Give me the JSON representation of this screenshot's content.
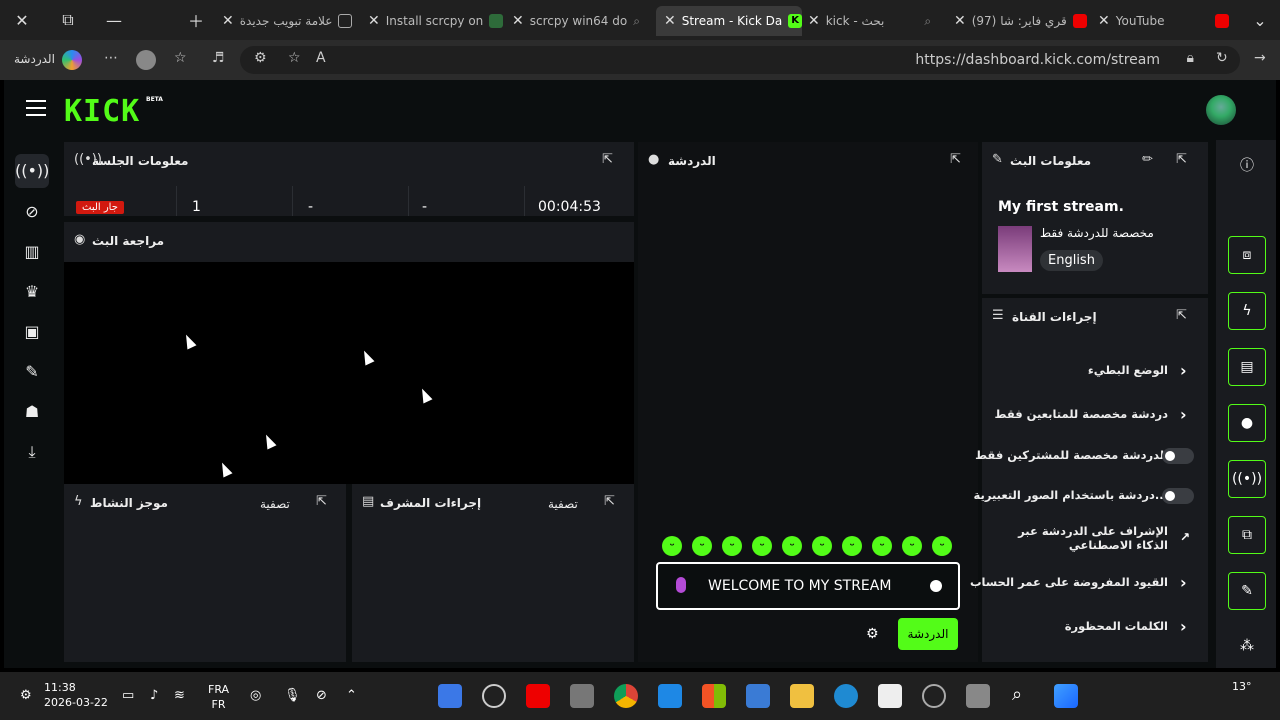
{
  "browser": {
    "tabs": [
      {
        "title": "علامة تبويب جديدة",
        "active": false
      },
      {
        "title": "Install scrcpy on",
        "active": false
      },
      {
        "title": "scrcpy win64 do",
        "active": false
      },
      {
        "title": "Stream - Kick Da",
        "active": true
      },
      {
        "title": "kick - بحث",
        "active": false
      },
      {
        "title": "(97) قري فاير: شا",
        "active": false
      },
      {
        "title": "YouTube",
        "active": false
      }
    ],
    "url": "https://dashboard.kick.com/stream",
    "copilot_label": "الدردشة"
  },
  "app": {
    "logo": "KICK",
    "logo_badge": "BETA",
    "colors": {
      "accent": "#53fc18",
      "live": "#d2190f",
      "panel": "#191b1f"
    },
    "session_info": {
      "title": "معلومات الجلسة",
      "live_badge": "جار البث",
      "stats": [
        "1",
        "-",
        "-",
        "00:04:53"
      ]
    },
    "stream_preview": {
      "title": "مراجعة البث"
    },
    "activity_feed": {
      "title": "موجز النشاط",
      "filter": "تصفية"
    },
    "mod_actions": {
      "title": "إجراءات المشرف",
      "filter": "تصفية"
    },
    "chat": {
      "title": "الدردشة",
      "input_value": "WELCOME TO MY STREAM",
      "send_label": "الدردشة"
    },
    "stream_info": {
      "title": "معلومات البث",
      "stream_title": "My first stream.",
      "category": "مخصصة للدردشة فقط",
      "language": "English"
    },
    "channel_actions": {
      "title": "إجراءات القناة",
      "items": [
        {
          "label": "الوضع البطيء",
          "control": "chevron"
        },
        {
          "label": "دردشة مخصصة للمتابعين فقط",
          "control": "chevron"
        },
        {
          "label": "الدردشة مخصصة للمشتركين فقط",
          "control": "toggle"
        },
        {
          "label": "...دردشة باستخدام الصور التعبيرية",
          "control": "toggle"
        },
        {
          "label": "الإشراف على الدردشة عبر الذكاء الاصطناعي",
          "control": "external"
        },
        {
          "label": "القيود المفروضة على عمر الحساب",
          "control": "chevron"
        },
        {
          "label": "الكلمات المحظورة",
          "control": "chevron"
        }
      ]
    }
  },
  "taskbar": {
    "time": "11:38",
    "date": "2026-03-22",
    "lang": "FRA",
    "lang_sub": "FR",
    "weather": "13°"
  }
}
